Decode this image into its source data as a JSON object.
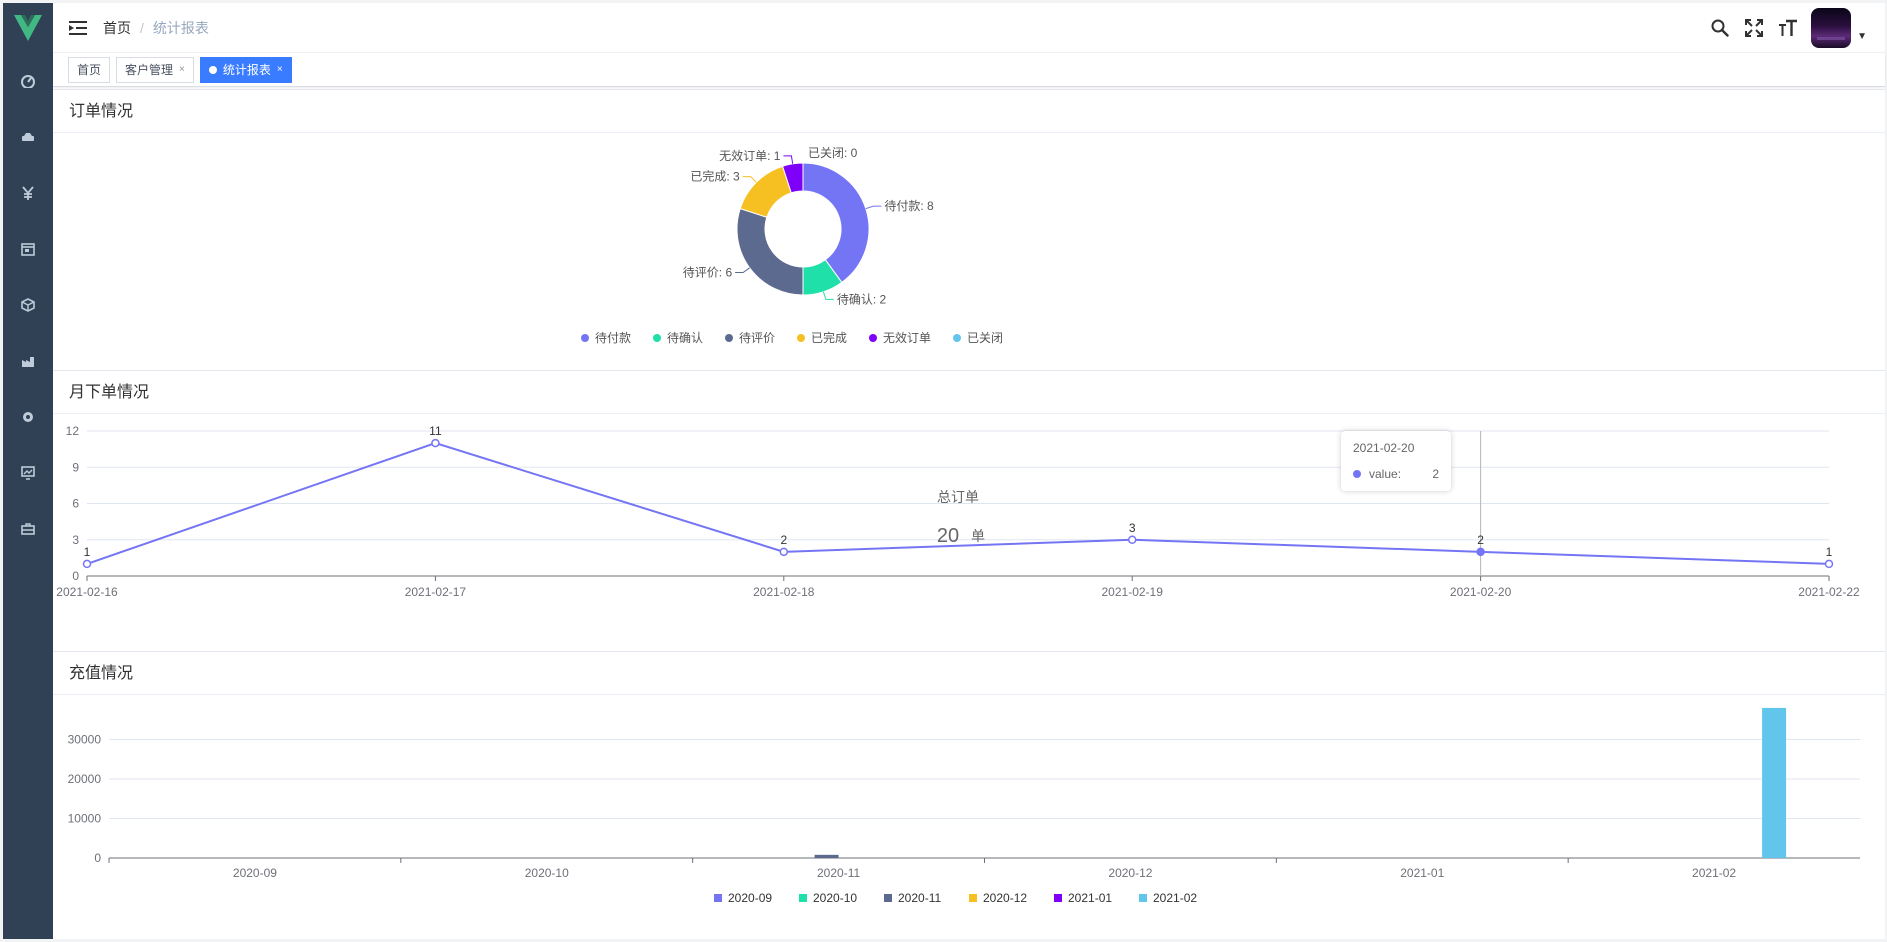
{
  "sidebar": {
    "items": [
      {
        "icon": "dashboard-icon"
      },
      {
        "icon": "car-icon"
      },
      {
        "icon": "yen-icon"
      },
      {
        "icon": "calendar-icon"
      },
      {
        "icon": "box-icon"
      },
      {
        "icon": "factory-chart-icon"
      },
      {
        "icon": "gear-icon"
      },
      {
        "icon": "monitor-chart-icon"
      },
      {
        "icon": "briefcase-icon"
      }
    ]
  },
  "navbar": {
    "breadcrumb": {
      "home": "首页",
      "separator": "/",
      "current": "统计报表"
    }
  },
  "tags": [
    {
      "label": "首页",
      "active": false
    },
    {
      "label": "客户管理",
      "active": false,
      "close": "×"
    },
    {
      "label": "统计报表",
      "active": true,
      "close": "×"
    }
  ],
  "colors": {
    "accent": "#3a7cff",
    "palette": [
      "#7475f5",
      "#1ee0a8",
      "#5d6a90",
      "#f6c022",
      "#7e00f9",
      "#62c6ec"
    ]
  },
  "orders": {
    "title": "订单情况",
    "chart_data": {
      "type": "pie",
      "slices": [
        {
          "name": "待付款",
          "value": 8
        },
        {
          "name": "待确认",
          "value": 2
        },
        {
          "name": "待评价",
          "value": 6
        },
        {
          "name": "已完成",
          "value": 3
        },
        {
          "name": "无效订单",
          "value": 1
        },
        {
          "name": "已关闭",
          "value": 0
        }
      ],
      "donut": true,
      "legend": "bottom"
    }
  },
  "monthly": {
    "title": "月下单情况",
    "center_label": "总订单",
    "center_value": "20",
    "center_unit": "单",
    "tooltip": {
      "date": "2021-02-20",
      "key": "value:",
      "value": "2"
    },
    "chart_data": {
      "type": "line",
      "x": [
        "2021-02-16",
        "2021-02-17",
        "2021-02-18",
        "2021-02-19",
        "2021-02-20",
        "2021-02-22"
      ],
      "series": [
        {
          "values": [
            1,
            11,
            2,
            3,
            2,
            1
          ]
        }
      ],
      "ylim": [
        0,
        12
      ],
      "yticks": [
        0,
        3,
        6,
        9,
        12
      ],
      "grid": true,
      "data_labels": true
    }
  },
  "recharge": {
    "title": "充值情况",
    "chart_data": {
      "type": "bar",
      "categories": [
        "2020-09",
        "2020-10",
        "2020-11",
        "2020-12",
        "2021-01",
        "2021-02"
      ],
      "series": [
        {
          "name": "2020-09",
          "values": [
            0,
            0,
            0,
            0,
            0,
            0
          ]
        },
        {
          "name": "2020-10",
          "values": [
            0,
            0,
            0,
            0,
            0,
            0
          ]
        },
        {
          "name": "2020-11",
          "values": [
            0,
            0,
            800,
            0,
            0,
            0
          ]
        },
        {
          "name": "2020-12",
          "values": [
            0,
            0,
            0,
            0,
            0,
            0
          ]
        },
        {
          "name": "2021-01",
          "values": [
            0,
            0,
            0,
            0,
            0,
            0
          ]
        },
        {
          "name": "2021-02",
          "values": [
            0,
            0,
            0,
            0,
            0,
            38000
          ]
        }
      ],
      "ylim": [
        0,
        40000
      ],
      "yticks": [
        0,
        10000,
        20000,
        30000
      ],
      "grid": true,
      "legend": "bottom"
    }
  }
}
